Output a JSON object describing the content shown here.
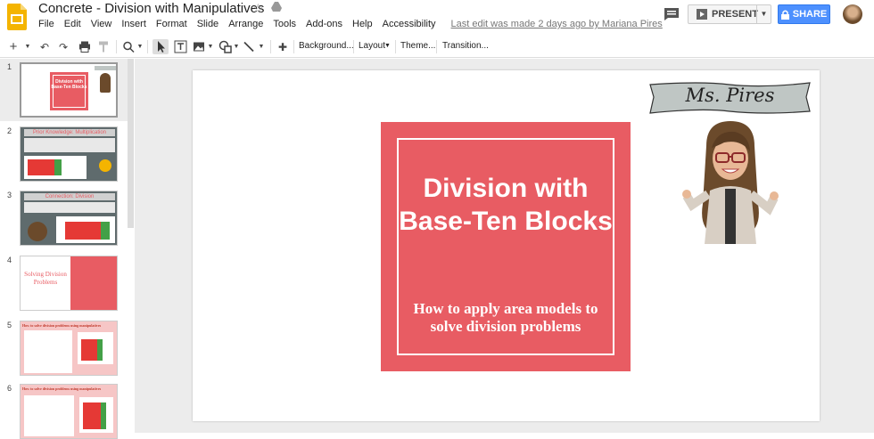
{
  "app": {
    "title": "Concrete - Division with Manipulatives",
    "menus": [
      "File",
      "Edit",
      "View",
      "Insert",
      "Format",
      "Slide",
      "Arrange",
      "Tools",
      "Add-ons",
      "Help",
      "Accessibility"
    ],
    "last_edit": "Last edit was made 2 days ago by Mariana Pires",
    "present_label": "PRESENT",
    "share_label": "SHARE"
  },
  "toolbar": {
    "background_label": "Background...",
    "layout_label": "Layout",
    "theme_label": "Theme...",
    "transition_label": "Transition..."
  },
  "filmstrip": {
    "slides": [
      {
        "num": "1",
        "title": "Division with Base-Ten Blocks"
      },
      {
        "num": "2",
        "title": "Prior Knowledge: Multiplication"
      },
      {
        "num": "3",
        "title": "Connection: Division"
      },
      {
        "num": "4",
        "title": "Solving Division Problems"
      },
      {
        "num": "5",
        "title": "How to solve division problems using manipulatives"
      },
      {
        "num": "6",
        "title": "How to solve division problems using manipulatives"
      }
    ]
  },
  "slide": {
    "banner": "Ms. Pires",
    "title": "Division with Base-Ten Blocks",
    "subtitle": "How to apply area models to solve division problems"
  },
  "colors": {
    "title_box": "#e85c63",
    "share": "#4d90fe",
    "slides_yellow": "#f4b400"
  }
}
